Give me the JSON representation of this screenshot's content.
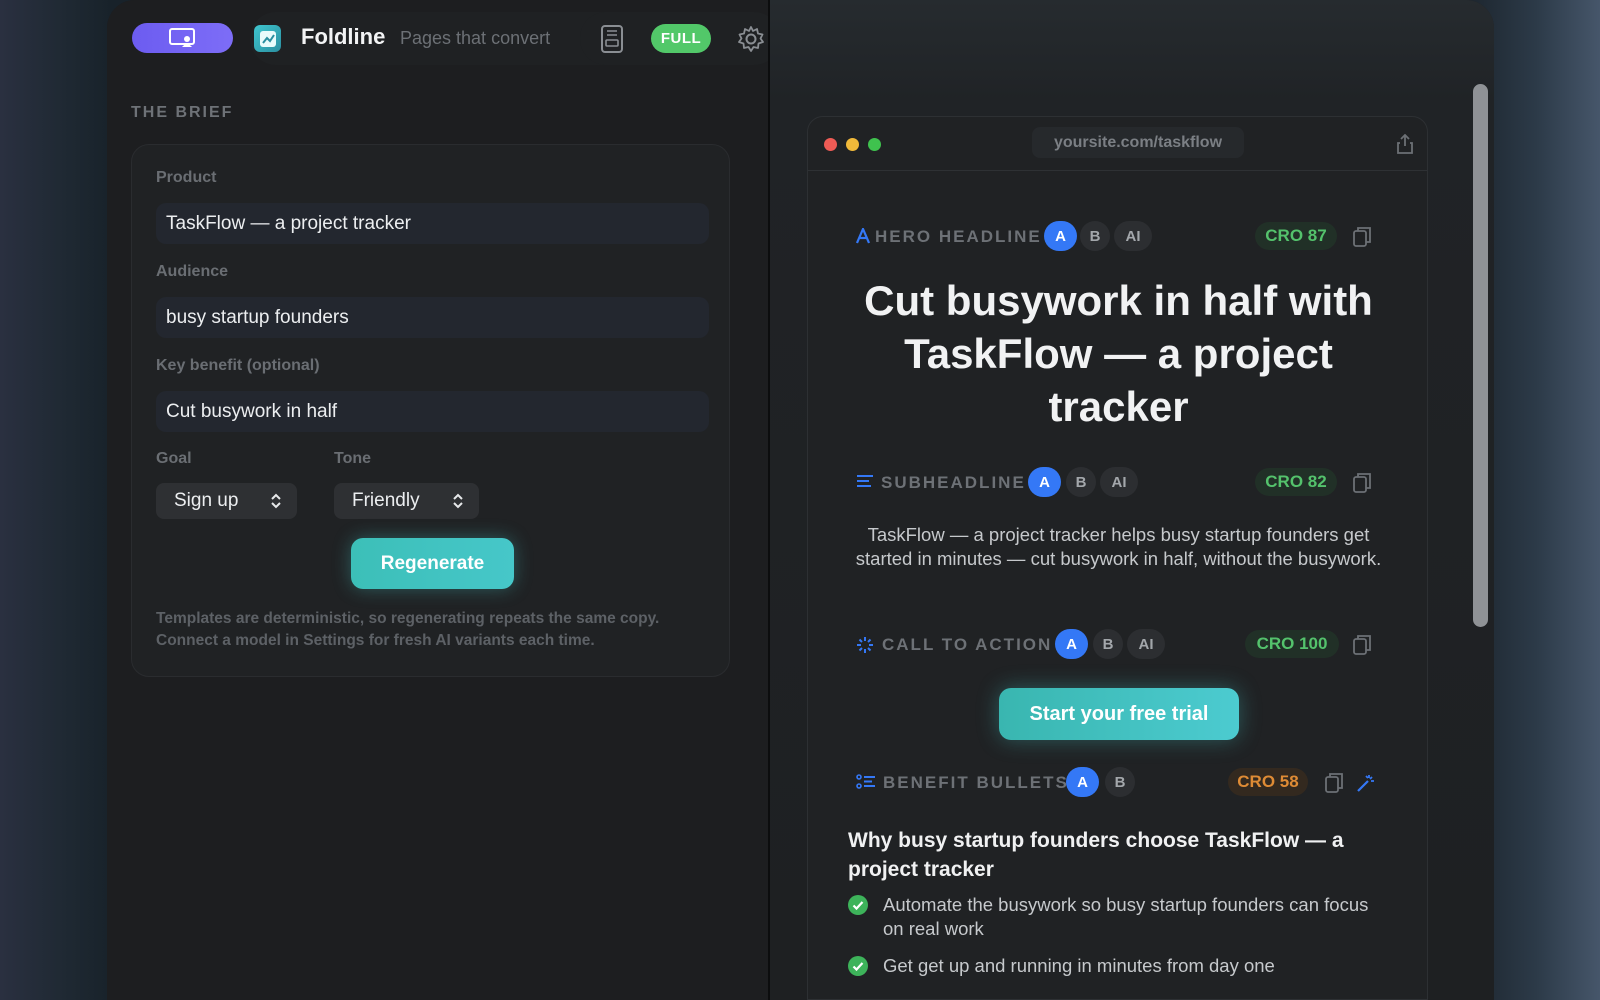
{
  "app": {
    "name": "Foldline",
    "tagline": "Pages that convert",
    "plan_badge": "FULL",
    "icons": [
      "presentation-icon",
      "app-logo-icon",
      "export-icon",
      "gear-icon"
    ],
    "colors": {
      "accent_purple": "#6c5cf0",
      "accent_teal": "#3fc3bf",
      "plan_green": "#52c869",
      "chip_blue": "#3478f6"
    }
  },
  "brief": {
    "section_title": "THE BRIEF",
    "product_label": "Product",
    "product_value": "TaskFlow — a project tracker",
    "audience_label": "Audience",
    "audience_value": "busy startup founders",
    "benefit_label": "Key benefit (optional)",
    "benefit_value": "Cut busywork in half",
    "goal_label": "Goal",
    "goal_value": "Sign up",
    "tone_label": "Tone",
    "tone_value": "Friendly",
    "regenerate_label": "Regenerate",
    "footnote": "Templates are deterministic, so regenerating repeats the same copy. Connect a model in Settings for fresh AI variants each time."
  },
  "preview": {
    "url": "yoursite.com/taskflow",
    "sections": {
      "hero": {
        "title": "HERO HEADLINE",
        "variants": [
          "A",
          "B",
          "AI"
        ],
        "active_variant": "A",
        "cro": "CRO 87",
        "text": "Cut busywork in half with TaskFlow — a project tracker"
      },
      "subheadline": {
        "title": "SUBHEADLINE",
        "variants": [
          "A",
          "B",
          "AI"
        ],
        "active_variant": "A",
        "cro": "CRO 82",
        "text": "TaskFlow — a project tracker helps busy startup founders get started in minutes — cut busywork in half, without the busywork."
      },
      "cta": {
        "title": "CALL TO ACTION",
        "variants": [
          "A",
          "B",
          "AI"
        ],
        "active_variant": "A",
        "cro": "CRO 100",
        "button": "Start your free trial"
      },
      "benefits": {
        "title": "BENEFIT BULLETS",
        "variants": [
          "A",
          "B"
        ],
        "active_variant": "A",
        "cro": "CRO 58",
        "heading": "Why busy startup founders choose TaskFlow — a project tracker",
        "bullets": [
          "Automate the busywork so busy startup founders can focus on real work",
          "Get get up and running in minutes from day one"
        ]
      }
    }
  }
}
